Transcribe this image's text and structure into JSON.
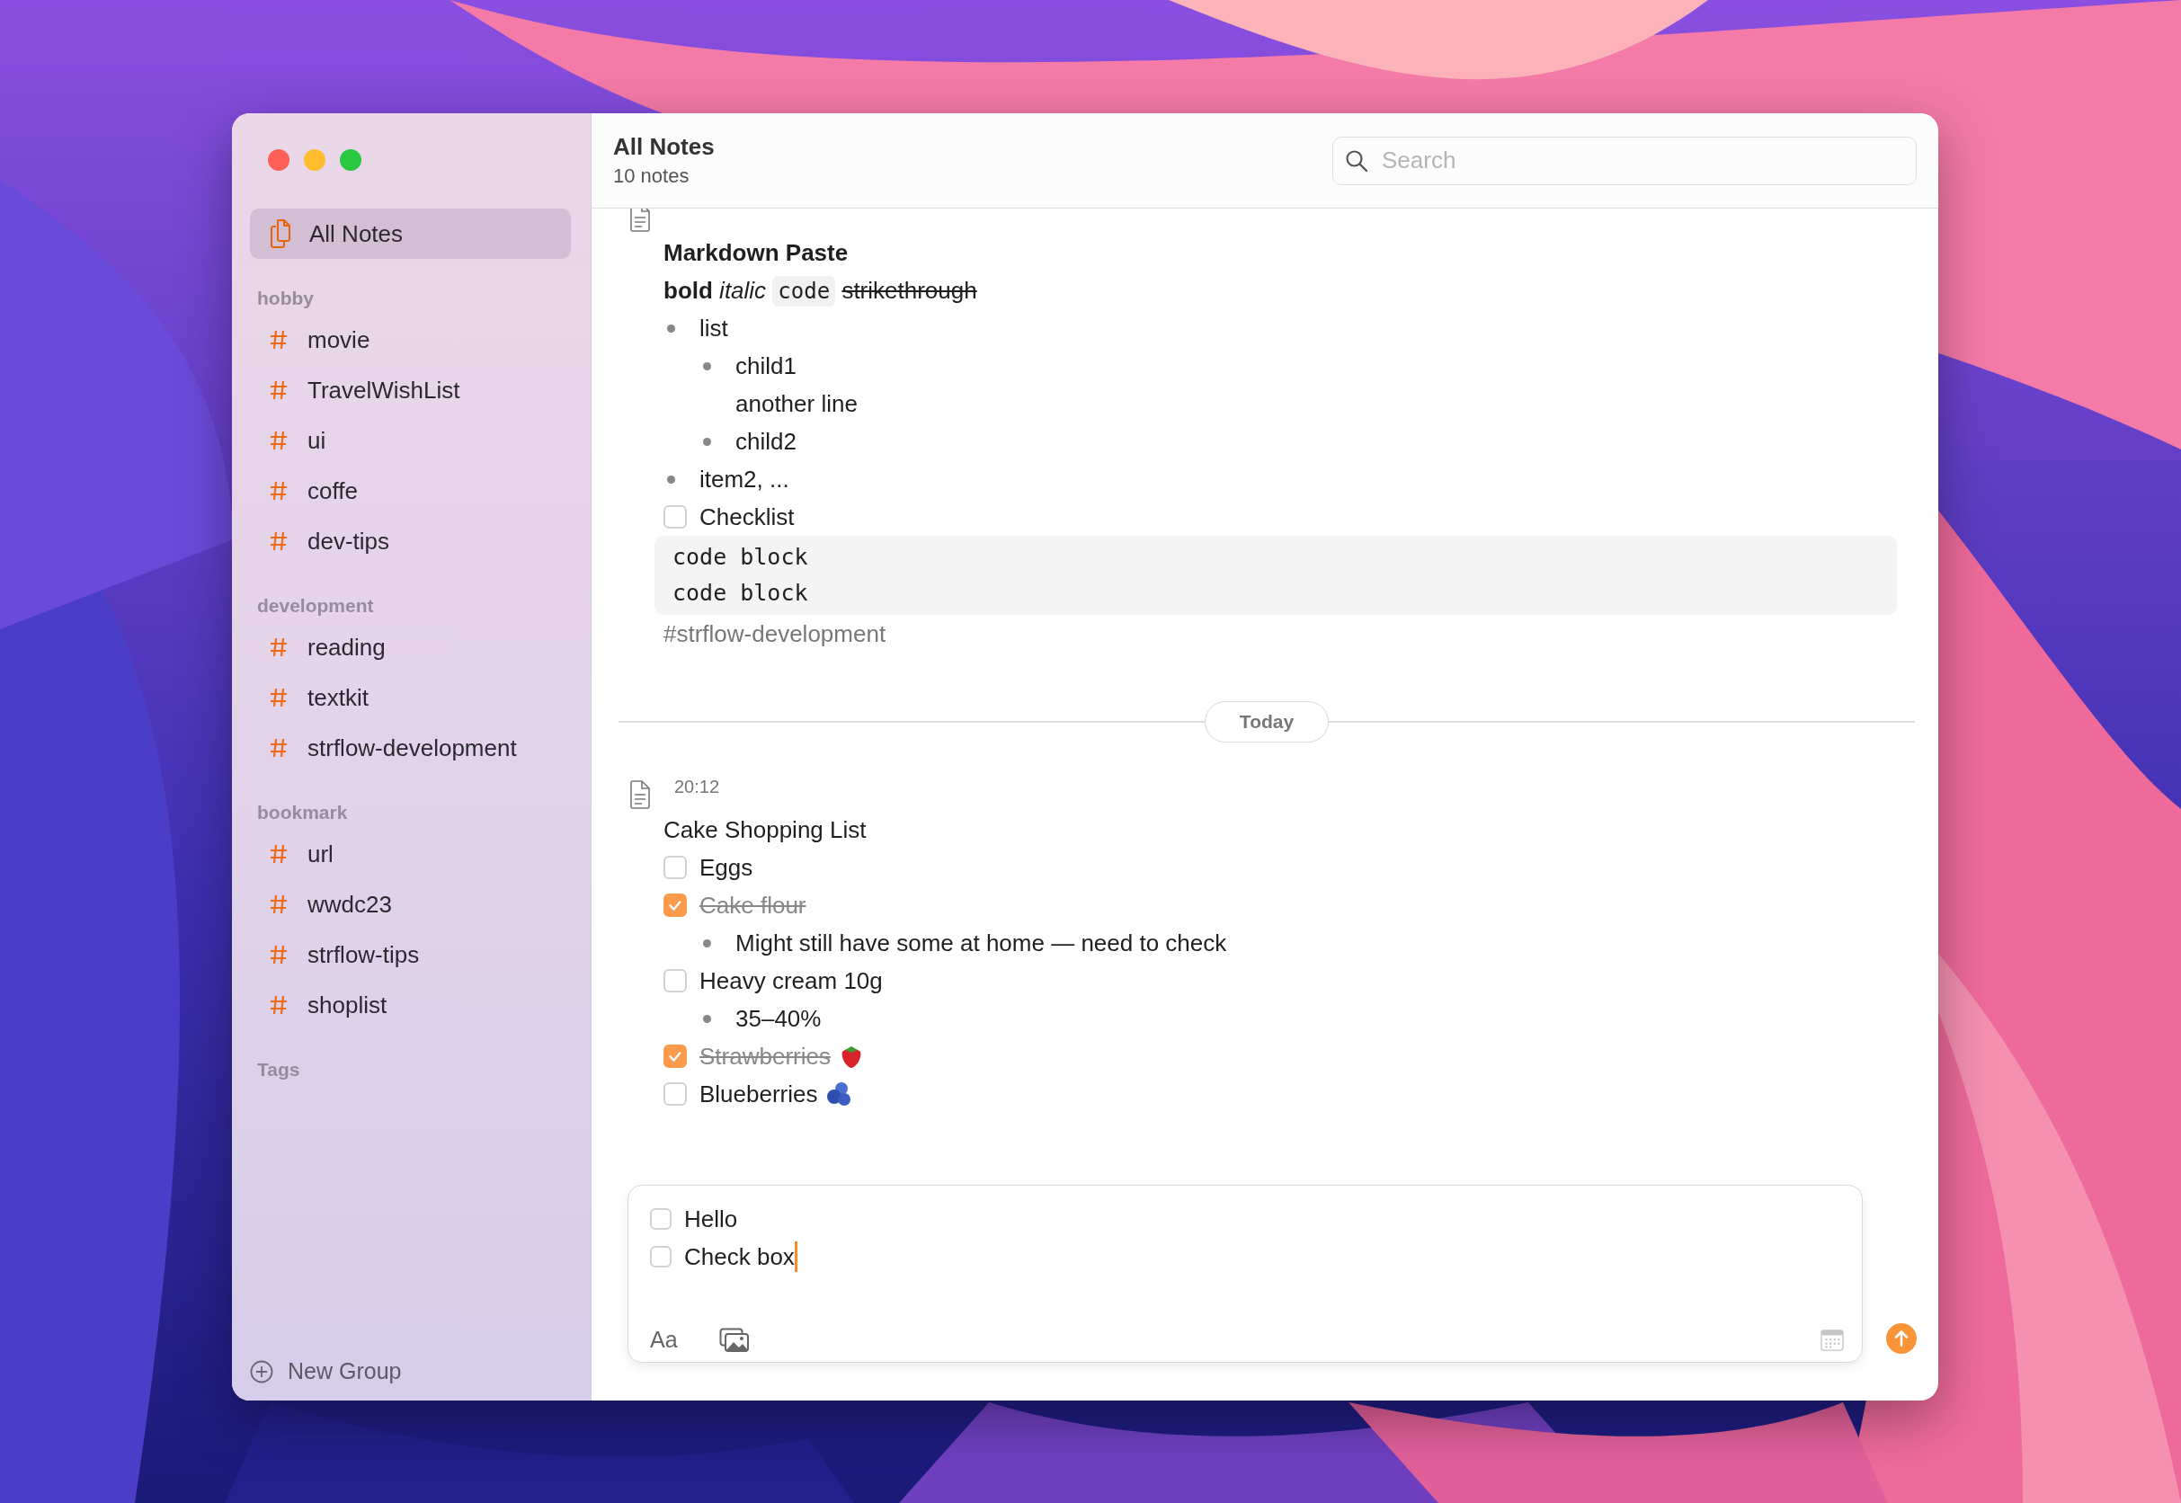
{
  "sidebar": {
    "items": [
      {
        "label": "All Notes",
        "selected": true
      }
    ],
    "groups": [
      {
        "title": "hobby",
        "tags": [
          {
            "label": "movie"
          },
          {
            "label": "TravelWishList"
          },
          {
            "label": "ui"
          },
          {
            "label": "coffe"
          },
          {
            "label": "dev-tips"
          }
        ]
      },
      {
        "title": "development",
        "tags": [
          {
            "label": "reading"
          },
          {
            "label": "textkit"
          },
          {
            "label": "strflow-development"
          }
        ]
      },
      {
        "title": "bookmark",
        "tags": [
          {
            "label": "url"
          },
          {
            "label": "wwdc23"
          },
          {
            "label": "strflow-tips"
          },
          {
            "label": "shoplist"
          }
        ]
      },
      {
        "title": "Tags"
      }
    ],
    "new_group": "New Group"
  },
  "header": {
    "title": "All Notes",
    "subtitle": "10 notes",
    "search": {
      "placeholder": "Search"
    }
  },
  "notes": [
    {
      "blocks": [
        {
          "kind": "title",
          "bold": true,
          "text": "Markdown Paste"
        },
        {
          "kind": "formatted",
          "segments": [
            {
              "kind": "bold",
              "text": "bold"
            },
            {
              "kind": "italic",
              "text": "italic"
            },
            {
              "kind": "code",
              "text": "code"
            },
            {
              "kind": "strike",
              "text": "strikethrough"
            }
          ]
        },
        {
          "kind": "bullet",
          "text": "list",
          "children": [
            {
              "kind": "bullet",
              "text": "child1"
            },
            {
              "kind": "para",
              "text": "another line"
            },
            {
              "kind": "bullet",
              "text": "child2"
            }
          ]
        },
        {
          "kind": "bullet",
          "text": "item2, ..."
        },
        {
          "kind": "checkbox",
          "text": "Checklist",
          "checked": false
        },
        {
          "kind": "code",
          "lines": [
            "code block",
            "code block"
          ]
        },
        {
          "kind": "tag",
          "text": "#strflow-development"
        }
      ]
    },
    {
      "time": "20:12",
      "blocks": [
        {
          "kind": "title",
          "bold": false,
          "text": "Cake Shopping List"
        },
        {
          "kind": "checkbox",
          "text": "Eggs",
          "checked": false
        },
        {
          "kind": "checkbox",
          "text": "Cake flour",
          "checked": true,
          "children": [
            {
              "kind": "bullet",
              "text": "Might still have some at home — need to check"
            }
          ]
        },
        {
          "kind": "checkbox",
          "text": "Heavy cream 10g",
          "checked": false,
          "children": [
            {
              "kind": "bullet",
              "text": "35–40%"
            }
          ]
        },
        {
          "kind": "checkbox",
          "text": "Strawberries",
          "checked": true,
          "trailing_icon": true
        },
        {
          "kind": "checkbox",
          "text": "Blueberries",
          "checked": false,
          "trailing_icon": true
        }
      ]
    }
  ],
  "divider": {
    "label": "Today"
  },
  "composer": {
    "lines": [
      {
        "text": "Hello",
        "checked": false
      },
      {
        "text": "Check box",
        "checked": false
      }
    ],
    "format_button": "Aa"
  }
}
